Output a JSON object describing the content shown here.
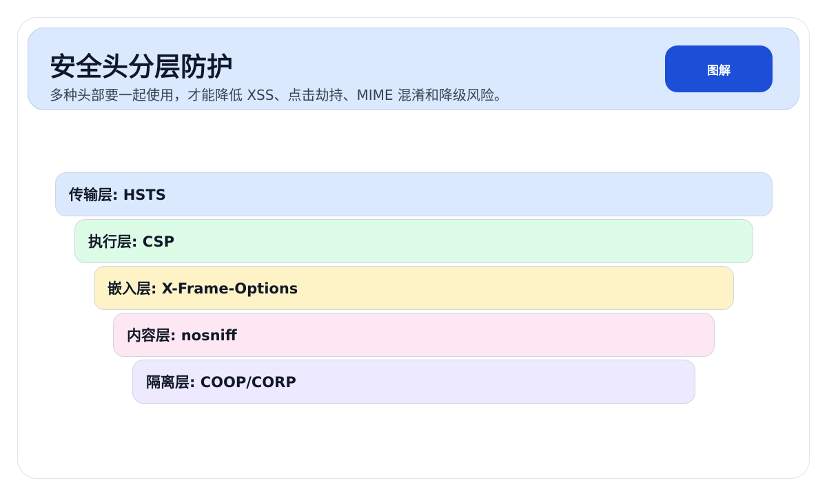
{
  "header": {
    "title": "安全头分层防护",
    "subtitle": "多种头部要一起使用，才能降低 XSS、点击劫持、MIME 混淆和降级风险。",
    "diagram_button_label": "图解",
    "accent_color": "#1d4ed8",
    "background_color": "#dbe9fe"
  },
  "layers": [
    {
      "label": "传输层: HSTS",
      "color": "#dbe9fe"
    },
    {
      "label": "执行层: CSP",
      "color": "#dcfce7"
    },
    {
      "label": "嵌入层: X-Frame-Options",
      "color": "#fef3c6"
    },
    {
      "label": "内容层: nosniff",
      "color": "#fce7f3"
    },
    {
      "label": "隔离层: COOP/CORP",
      "color": "#ede9fe"
    }
  ]
}
